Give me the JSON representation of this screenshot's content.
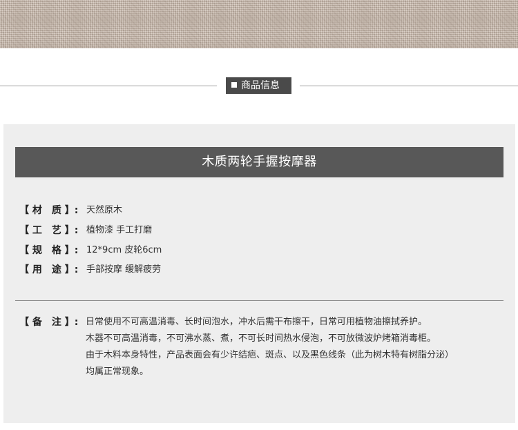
{
  "section": {
    "tag_label": "商品信息"
  },
  "product": {
    "title": "木质两轮手握按摩器"
  },
  "specs": [
    {
      "label": "【 材　质 】:",
      "value": "天然原木"
    },
    {
      "label": "【 工　艺 】:",
      "value": "植物漆  手工打磨"
    },
    {
      "label": "【 规　格 】:",
      "value": "12*9cm  皮轮6cm"
    },
    {
      "label": "【 用　途 】:",
      "value": "手部按摩  缓解疲劳"
    }
  ],
  "notes": {
    "label": "【 备　注 】:",
    "lines": [
      "日常使用不可高温消毒、长时间泡水，冲水后需干布擦干，日常可用植物油擦拭养护。",
      "木器不可高温消毒，不可沸水蒸、煮，不可长时间热水侵泡，不可放微波炉烤箱消毒柜。",
      "由于木料本身特性，产品表面会有少许结疤、斑点、以及黑色线条（此为树木特有树脂分泌）",
      "均属正常现象。"
    ]
  },
  "colors": {
    "panel_bg": "#eeeeee",
    "title_bar": "#585858",
    "section_tag": "#4a4a4a",
    "linen": "#cdbdb0"
  }
}
